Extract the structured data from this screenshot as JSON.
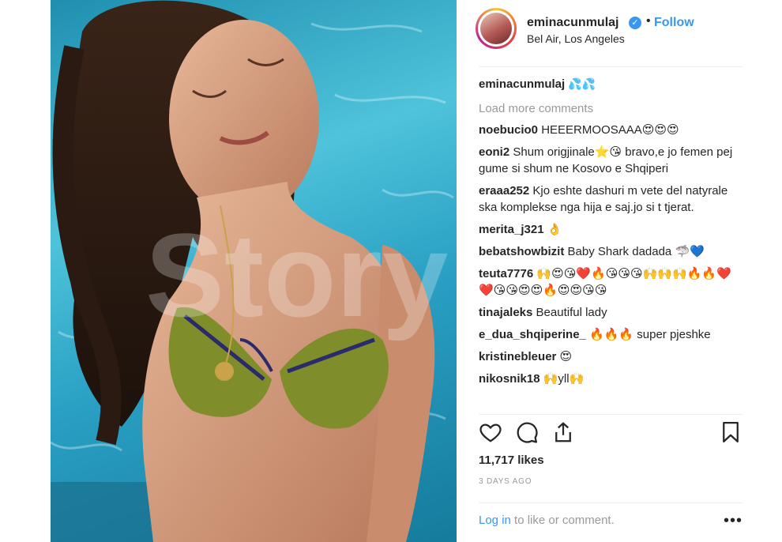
{
  "post": {
    "username": "eminacunmulaj",
    "follow_label": "Follow",
    "separator": "•",
    "location": "Bel Air, Los Angeles",
    "watermark": "Story"
  },
  "caption": {
    "username": "eminacunmulaj",
    "text": "💦💦"
  },
  "load_more": "Load more comments",
  "comments": [
    {
      "user": "noebucio0",
      "text": "HEEERMOOSAAA😍😍😍"
    },
    {
      "user": "eoni2",
      "text": "Shum origjinale⭐😘 bravo,e jo femen pej gume si shum ne Kosovo e Shqiperi"
    },
    {
      "user": "eraaa252",
      "text": "Kjo eshte dashuri m vete del natyrale ska komplekse nga hija e saj.jo si t tjerat."
    },
    {
      "user": "merita_j321",
      "text": "👌"
    },
    {
      "user": "bebatshowbizit",
      "text": "Baby Shark dadada 🦈💙"
    },
    {
      "user": "teuta7776",
      "text": "🙌😍😘❤️🔥😘😘😘🙌🙌🙌🔥🔥❤️❤️😘😘😍😍🔥😍😍😘😘"
    },
    {
      "user": "tinajaleks",
      "text": "Beautiful lady"
    },
    {
      "user": "e_dua_shqiperine_",
      "text": "🔥🔥🔥 super pjeshke"
    },
    {
      "user": "kristinebleuer",
      "text": "😍"
    },
    {
      "user": "nikosnik18",
      "text": "🙌yll🙌"
    }
  ],
  "icons": {
    "like": "heart-icon",
    "comment": "comment-icon",
    "share": "share-icon",
    "save": "bookmark-icon",
    "verified": "verified-badge-icon",
    "more": "more-options-icon"
  },
  "likes": "11,717 likes",
  "time": "3 DAYS AGO",
  "login": {
    "link": "Log in",
    "rest": " to like or comment."
  },
  "more_glyph": "•••",
  "colors": {
    "accent": "#3897f0",
    "text": "#262626",
    "muted": "#999999",
    "pool": "#2aa0c4"
  }
}
